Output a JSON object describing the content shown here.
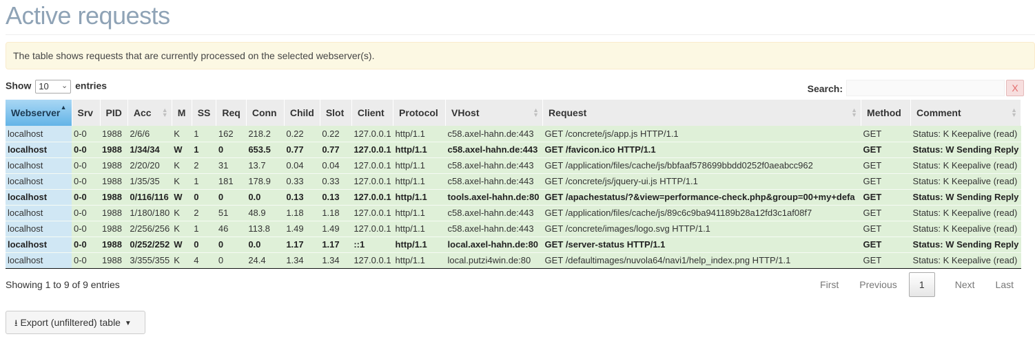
{
  "page": {
    "title": "Active requests",
    "info": "The table shows requests that are currently processed on the selected webserver(s)."
  },
  "length": {
    "show_label": "Show",
    "value": "10",
    "entries_label": "entries"
  },
  "search": {
    "label": "Search:",
    "value": "",
    "clear_label": "X"
  },
  "table": {
    "columns": [
      "Webserver",
      "Srv",
      "PID",
      "Acc",
      "M",
      "SS",
      "Req",
      "Conn",
      "Child",
      "Slot",
      "Client",
      "Protocol",
      "VHost",
      "Request",
      "Method",
      "Comment"
    ],
    "rows": [
      {
        "bold": false,
        "cells": [
          "localhost",
          "0-0",
          "1988",
          "2/6/6",
          "K",
          "1",
          "162",
          "218.2",
          "0.22",
          "0.22",
          "127.0.0.1",
          "http/1.1",
          "c58.axel-hahn.de:443",
          "GET /concrete/js/app.js HTTP/1.1",
          "GET",
          "Status: K Keepalive (read)"
        ]
      },
      {
        "bold": true,
        "cells": [
          "localhost",
          "0-0",
          "1988",
          "1/34/34",
          "W",
          "1",
          "0",
          "653.5",
          "0.77",
          "0.77",
          "127.0.0.1",
          "http/1.1",
          "c58.axel-hahn.de:443",
          "GET /favicon.ico HTTP/1.1",
          "GET",
          "Status: W Sending Reply"
        ]
      },
      {
        "bold": false,
        "cells": [
          "localhost",
          "0-0",
          "1988",
          "2/20/20",
          "K",
          "2",
          "31",
          "13.7",
          "0.04",
          "0.04",
          "127.0.0.1",
          "http/1.1",
          "c58.axel-hahn.de:443",
          "GET /application/files/cache/js/bbfaaf578699bbdd0252f0aeabcc962",
          "GET",
          "Status: K Keepalive (read)"
        ]
      },
      {
        "bold": false,
        "cells": [
          "localhost",
          "0-0",
          "1988",
          "1/35/35",
          "K",
          "1",
          "181",
          "178.9",
          "0.33",
          "0.33",
          "127.0.0.1",
          "http/1.1",
          "c58.axel-hahn.de:443",
          "GET /concrete/js/jquery-ui.js HTTP/1.1",
          "GET",
          "Status: K Keepalive (read)"
        ]
      },
      {
        "bold": true,
        "cells": [
          "localhost",
          "0-0",
          "1988",
          "0/116/116",
          "W",
          "0",
          "0",
          "0.0",
          "0.13",
          "0.13",
          "127.0.0.1",
          "http/1.1",
          "tools.axel-hahn.de:80",
          "GET /apachestatus/?&view=performance-check.php&group=00+my+defa",
          "GET",
          "Status: W Sending Reply"
        ]
      },
      {
        "bold": false,
        "cells": [
          "localhost",
          "0-0",
          "1988",
          "1/180/180",
          "K",
          "2",
          "51",
          "48.9",
          "1.18",
          "1.18",
          "127.0.0.1",
          "http/1.1",
          "c58.axel-hahn.de:443",
          "GET /application/files/cache/js/89c6c9ba941189b28a12fd3c1af08f7",
          "GET",
          "Status: K Keepalive (read)"
        ]
      },
      {
        "bold": false,
        "cells": [
          "localhost",
          "0-0",
          "1988",
          "2/256/256",
          "K",
          "1",
          "46",
          "113.8",
          "1.49",
          "1.49",
          "127.0.0.1",
          "http/1.1",
          "c58.axel-hahn.de:443",
          "GET /concrete/images/logo.svg HTTP/1.1",
          "GET",
          "Status: K Keepalive (read)"
        ]
      },
      {
        "bold": true,
        "cells": [
          "localhost",
          "0-0",
          "1988",
          "0/252/252",
          "W",
          "0",
          "0",
          "0.0",
          "1.17",
          "1.17",
          "::1",
          "http/1.1",
          "local.axel-hahn.de:80",
          "GET /server-status HTTP/1.1",
          "GET",
          "Status: W Sending Reply"
        ]
      },
      {
        "bold": false,
        "cells": [
          "localhost",
          "0-0",
          "1988",
          "3/355/355",
          "K",
          "4",
          "0",
          "24.4",
          "1.34",
          "1.34",
          "127.0.0.1",
          "http/1.1",
          "local.putzi4win.de:80",
          "GET /defaultimages/nuvola64/navi1/help_index.png HTTP/1.1",
          "GET",
          "Status: K Keepalive (read)"
        ]
      }
    ]
  },
  "footer": {
    "info": "Showing 1 to 9 of 9 entries",
    "first": "First",
    "previous": "Previous",
    "current_page": "1",
    "next": "Next",
    "last": "Last",
    "export_label": "Export (unfiltered) table",
    "export_icon": "download-icon"
  }
}
